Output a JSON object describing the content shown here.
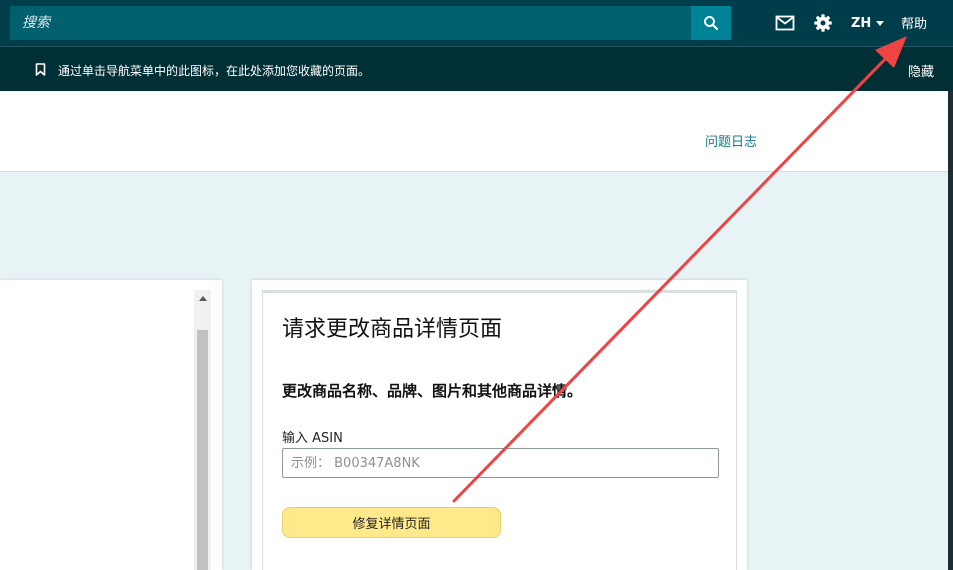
{
  "topbar": {
    "search_placeholder": "搜索",
    "lang_label": "ZH",
    "help_label": "帮助"
  },
  "bookmark_bar": {
    "message": "通过单击导航菜单中的此图标，在此处添加您收藏的页面。",
    "hide_label": "隐藏"
  },
  "header": {
    "issue_log_label": "问题日志"
  },
  "card": {
    "title": "请求更改商品详情页面",
    "subtitle": "更改商品名称、品牌、图片和其他商品详情。",
    "asin_label": "输入 ASIN",
    "asin_placeholder": "示例： B00347A8NK",
    "asin_value": "",
    "button_label": "修复详情页面"
  },
  "colors": {
    "topbar_bg": "#003d4a",
    "search_bg": "#00606d",
    "search_button_bg": "#008296",
    "link_color": "#0e7a8c",
    "button_yellow": "#ffe98a",
    "annotation_arrow": "#ef4444"
  },
  "icons": {
    "search": "search-icon",
    "mail": "mail-icon",
    "settings": "gear-icon",
    "bookmark": "bookmark-icon",
    "scroll_up": "scroll-up-icon"
  }
}
